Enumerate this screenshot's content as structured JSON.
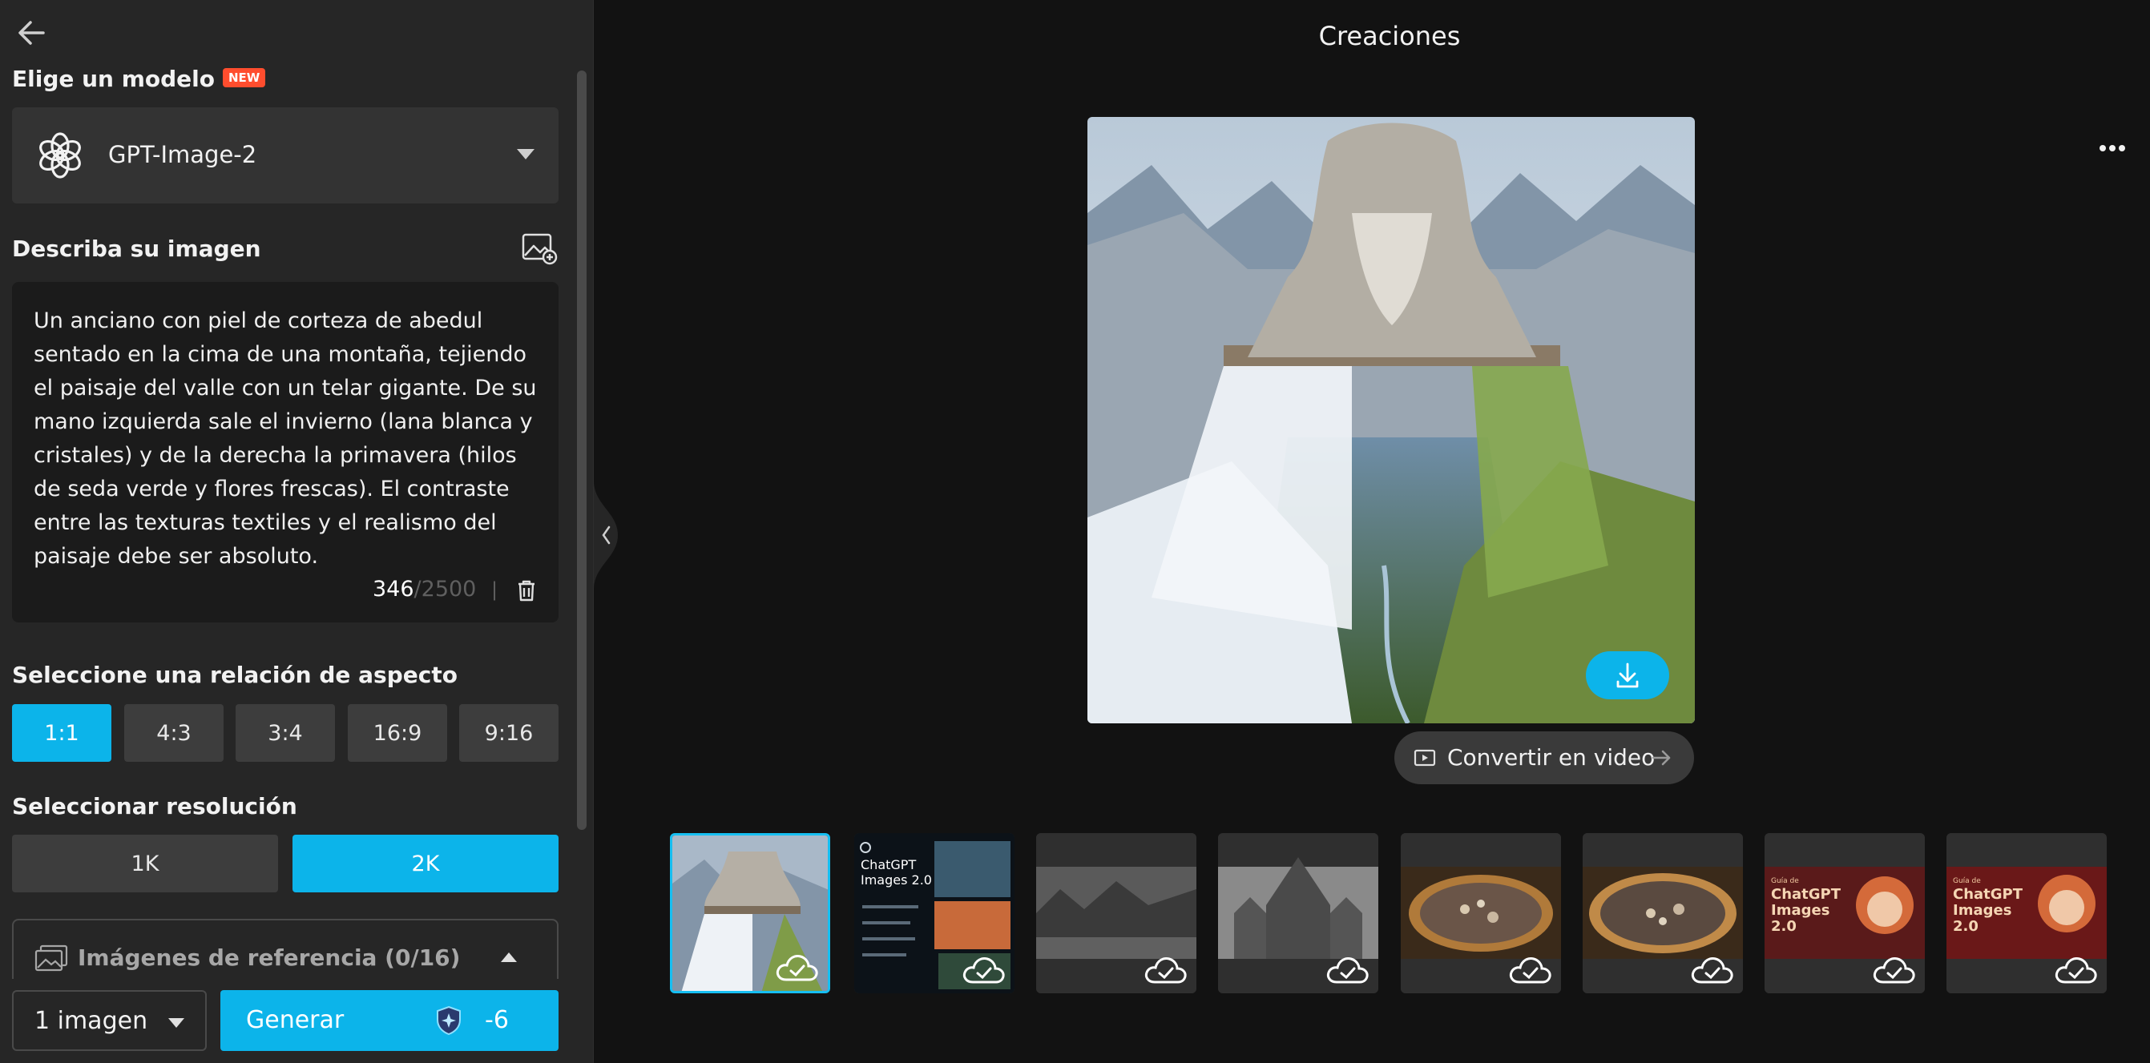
{
  "sidebar": {
    "model_section_title": "Elige un modelo",
    "new_badge": "NEW",
    "model_name": "GPT-Image-2",
    "prompt_section_title": "Describa su imagen",
    "prompt_text": "Un anciano con piel de corteza de abedul sentado en la cima de una montaña, tejiendo el paisaje del valle con un telar gigante. De su mano izquierda sale el invierno (lana blanca y cristales) y de la derecha la primavera (hilos de seda verde y flores frescas). El contraste entre las texturas textiles y el realismo del paisaje debe ser absoluto.",
    "char_used": "346",
    "char_max": "/2500",
    "char_separator": "|",
    "aspect_title": "Seleccione una relación de aspecto",
    "aspect_options": [
      "1:1",
      "4:3",
      "3:4",
      "16:9",
      "9:16"
    ],
    "aspect_selected": "1:1",
    "resolution_title": "Seleccionar resolución",
    "resolution_options": [
      "1K",
      "2K"
    ],
    "resolution_selected": "2K",
    "reference_label": "Imágenes de referencia (0/16)",
    "image_count": "1 imagen",
    "generate_label": "Generar",
    "credit_cost": "-6"
  },
  "main": {
    "title": "Creaciones",
    "convert_label": "Convertir en video",
    "thumbnails": [
      {
        "name": "ice-loom-elder",
        "selected": true
      },
      {
        "name": "chatgpt-images-2-banner",
        "selected": false,
        "text_lines": [
          "ChatGPT",
          "Images 2.0"
        ]
      },
      {
        "name": "dark-forest-castle",
        "selected": false
      },
      {
        "name": "gothic-cathedral",
        "selected": false
      },
      {
        "name": "jeweled-bowl-1",
        "selected": false
      },
      {
        "name": "jeweled-bowl-2",
        "selected": false
      },
      {
        "name": "chatgpt-guide-headphones-1",
        "selected": false,
        "text_lines": [
          "Guía de",
          "ChatGPT",
          "Images",
          "2.0"
        ]
      },
      {
        "name": "chatgpt-guide-headphones-2",
        "selected": false,
        "text_lines": [
          "Guía de",
          "ChatGPT",
          "Images",
          "2.0"
        ]
      }
    ]
  },
  "colors": {
    "accent": "#0cb4ea",
    "panel_bg": "#262626",
    "main_bg": "#121212",
    "badge": "#ff4d2e"
  }
}
